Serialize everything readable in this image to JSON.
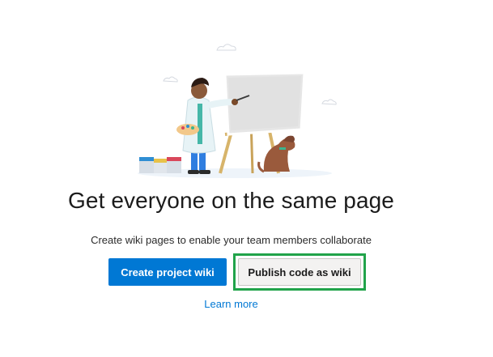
{
  "empty_state": {
    "headline": "Get everyone on the same page",
    "description": "Create wiki pages to enable your team members collaborate",
    "illustration_icon": "painter-at-easel-illustration"
  },
  "actions": {
    "create_label": "Create project wiki",
    "publish_label": "Publish code as wiki",
    "learn_more_label": "Learn more"
  },
  "colors": {
    "primary": "#0078d4",
    "highlight": "#21a34a",
    "secondary_bg": "#f3f2f1"
  }
}
